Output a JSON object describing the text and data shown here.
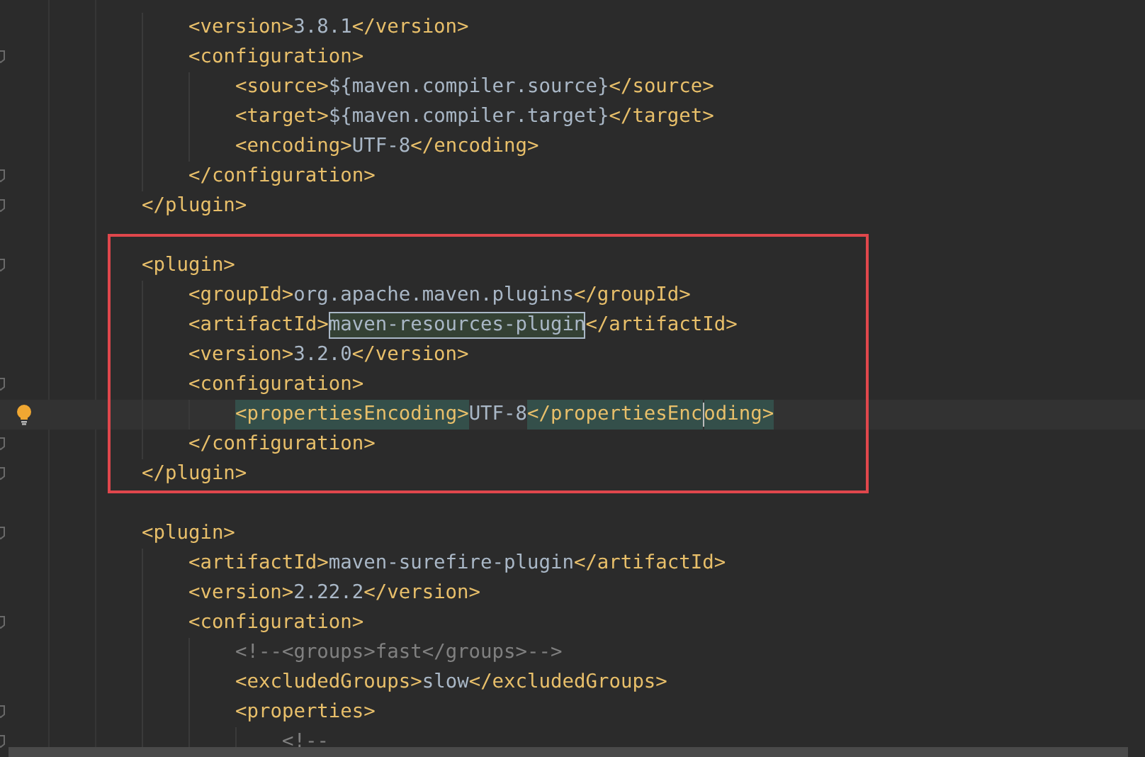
{
  "editor": {
    "lines": [
      {
        "children": [
          {
            "fold": false,
            "tokens": [
              {
                "kind": "tag",
                "text": "<version>"
              },
              {
                "kind": "value",
                "text": "3.8.1"
              },
              {
                "kind": "tag",
                "text": "</version>"
              }
            ]
          },
          {
            "fold": true,
            "tokens": [
              {
                "kind": "tag",
                "text": "<configuration>"
              }
            ],
            "children": [
              {
                "fold": false,
                "tokens": [
                  {
                    "kind": "tag",
                    "text": "<source>"
                  },
                  {
                    "kind": "value",
                    "text": "${maven.compiler.source}"
                  },
                  {
                    "kind": "tag",
                    "text": "</source>"
                  }
                ]
              },
              {
                "fold": false,
                "tokens": [
                  {
                    "kind": "tag",
                    "text": "<target>"
                  },
                  {
                    "kind": "value",
                    "text": "${maven.compiler.target}"
                  },
                  {
                    "kind": "tag",
                    "text": "</target>"
                  }
                ]
              },
              {
                "fold": false,
                "tokens": [
                  {
                    "kind": "tag",
                    "text": "<encoding>"
                  },
                  {
                    "kind": "value",
                    "text": "UTF-8"
                  },
                  {
                    "kind": "tag",
                    "text": "</encoding>"
                  }
                ]
              }
            ],
            "closing": {
              "fold": true,
              "tokens": [
                {
                  "kind": "tag",
                  "text": "</configuration>"
                }
              ]
            }
          }
        ],
        "closing": {
          "fold": true,
          "tokens": [
            {
              "kind": "tag",
              "text": "</plugin>"
            }
          ]
        }
      },
      {
        "fold": false
      },
      {
        "fold": true,
        "framed": true,
        "tokens": [
          {
            "kind": "tag",
            "text": "<plugin>"
          }
        ],
        "children": [
          {
            "fold": false,
            "tokens": [
              {
                "kind": "tag",
                "text": "<groupId>"
              },
              {
                "kind": "value",
                "text": "org.apache.maven.plugins"
              },
              {
                "kind": "tag",
                "text": "</groupId>"
              }
            ]
          },
          {
            "fold": false,
            "tokens": [
              {
                "kind": "tag",
                "text": "<artifactId>"
              },
              {
                "kind": "usage",
                "text": "maven-resources-plugin"
              },
              {
                "kind": "tag",
                "text": "</artifactId>"
              }
            ]
          },
          {
            "fold": false,
            "tokens": [
              {
                "kind": "tag",
                "text": "<version>"
              },
              {
                "kind": "value",
                "text": "3.2.0"
              },
              {
                "kind": "tag",
                "text": "</version>"
              }
            ]
          },
          {
            "fold": true,
            "tokens": [
              {
                "kind": "tag",
                "text": "<configuration>"
              }
            ],
            "children": [
              {
                "fold": false,
                "current": true,
                "bulb": true,
                "tokens": [
                  {
                    "kind": "match",
                    "text": "<propertiesEncoding>"
                  },
                  {
                    "kind": "value",
                    "text": "UTF-8"
                  },
                  {
                    "kind": "match",
                    "text": "</propertiesEnc"
                  },
                  {
                    "kind": "caret"
                  },
                  {
                    "kind": "match",
                    "text": "oding>"
                  }
                ]
              }
            ],
            "closing": {
              "fold": true,
              "tokens": [
                {
                  "kind": "tag",
                  "text": "</configuration>"
                }
              ]
            }
          }
        ],
        "closing": {
          "fold": true,
          "tokens": [
            {
              "kind": "tag",
              "text": "</plugin>"
            }
          ]
        }
      },
      {
        "fold": false
      },
      {
        "fold": true,
        "tokens": [
          {
            "kind": "tag",
            "text": "<plugin>"
          }
        ],
        "children": [
          {
            "fold": false,
            "tokens": [
              {
                "kind": "tag",
                "text": "<artifactId>"
              },
              {
                "kind": "value",
                "text": "maven-surefire-plugin"
              },
              {
                "kind": "tag",
                "text": "</artifactId>"
              }
            ]
          },
          {
            "fold": false,
            "tokens": [
              {
                "kind": "tag",
                "text": "<version>"
              },
              {
                "kind": "value",
                "text": "2.22.2"
              },
              {
                "kind": "tag",
                "text": "</version>"
              }
            ]
          },
          {
            "fold": true,
            "tokens": [
              {
                "kind": "tag",
                "text": "<configuration>"
              }
            ],
            "children": [
              {
                "fold": false,
                "tokens": [
                  {
                    "kind": "comment",
                    "text": "<!--<groups>fast</groups>-->"
                  }
                ]
              },
              {
                "fold": false,
                "tokens": [
                  {
                    "kind": "tag",
                    "text": "<excludedGroups>"
                  },
                  {
                    "kind": "value",
                    "text": "slow"
                  },
                  {
                    "kind": "tag",
                    "text": "</excludedGroups>"
                  }
                ]
              },
              {
                "fold": true,
                "tokens": [
                  {
                    "kind": "tag",
                    "text": "<properties>"
                  }
                ],
                "children": [
                  {
                    "fold": true,
                    "tokens": [
                      {
                        "kind": "comment",
                        "text": "<!--"
                      }
                    ]
                  }
                ]
              }
            ]
          }
        ]
      }
    ]
  }
}
